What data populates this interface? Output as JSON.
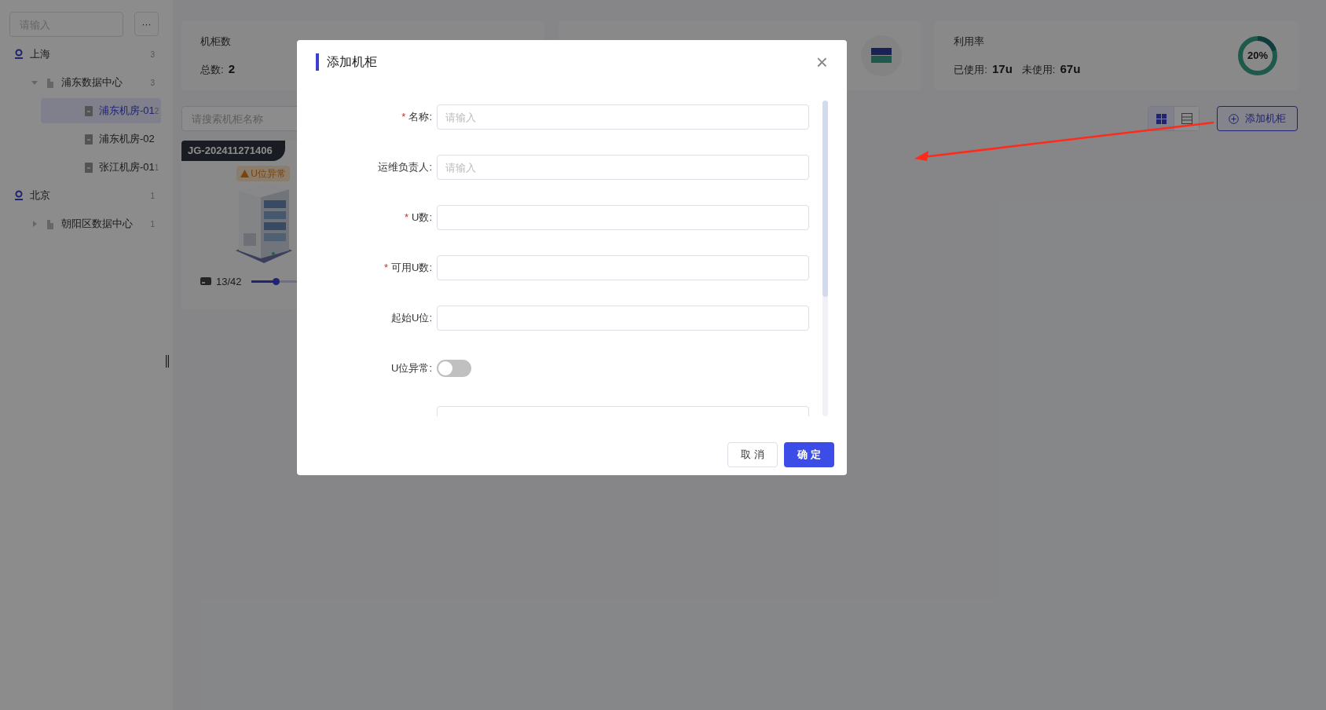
{
  "sidebar": {
    "search": {
      "placeholder": "请输入"
    },
    "more": "···",
    "tree": [
      {
        "kind": "city",
        "label": "上海",
        "count": "3",
        "selected": false,
        "children": [
          {
            "kind": "datacenter",
            "label": "浦东数据中心",
            "count": "3",
            "selected": false,
            "expanded": true,
            "children": [
              {
                "kind": "room",
                "label": "浦东机房-01",
                "count": "2",
                "selected": true
              },
              {
                "kind": "room",
                "label": "浦东机房-02",
                "selected": false
              },
              {
                "kind": "room",
                "label": "张江机房-01",
                "count": "1",
                "selected": false
              }
            ]
          }
        ]
      },
      {
        "kind": "city",
        "label": "北京",
        "count": "1",
        "selected": false,
        "children": [
          {
            "kind": "datacenter",
            "label": "朝阳区数据中心",
            "count": "1",
            "selected": false,
            "expanded": false
          }
        ]
      }
    ]
  },
  "stats": [
    {
      "kind": "count",
      "title": "机柜数",
      "items": [
        {
          "label": "总数:",
          "value": "2"
        }
      ]
    },
    {
      "kind": "device"
    },
    {
      "kind": "usage",
      "title": "利用率",
      "items": [
        {
          "label": "已使用:",
          "value": "17u"
        },
        {
          "label": "未使用:",
          "value": "67u"
        }
      ],
      "ring": {
        "label": "20%",
        "level": 0.2
      }
    }
  ],
  "toolbar": {
    "search": {
      "placeholder": "请搜索机柜名称"
    },
    "views": [
      {
        "kind": "grid",
        "selected": true
      },
      {
        "kind": "list",
        "selected": false
      }
    ],
    "add_button": "添加机柜"
  },
  "cabinets": [
    {
      "name": "JG-202411271406",
      "warning": "U位异常",
      "usage": "13/42",
      "level": 0.31
    }
  ],
  "dialog": {
    "title": "添加机柜",
    "close": "×",
    "required_mark": "*",
    "fields": [
      {
        "kind": "input",
        "label": "名称:",
        "required": true,
        "placeholder": "请输入"
      },
      {
        "kind": "input",
        "label": "运维负责人:",
        "required": false,
        "placeholder": "请输入"
      },
      {
        "kind": "input",
        "label": "U数:",
        "required": true
      },
      {
        "kind": "input",
        "label": "可用U数:",
        "required": true
      },
      {
        "kind": "input",
        "label": "起始U位:",
        "required": false
      },
      {
        "kind": "switch",
        "label": "U位异常:",
        "required": false,
        "on": false
      },
      {
        "kind": "input",
        "required": false
      }
    ],
    "buttons": [
      {
        "label": "取 消",
        "primary": false
      },
      {
        "label": "确 定",
        "primary": true
      }
    ]
  }
}
